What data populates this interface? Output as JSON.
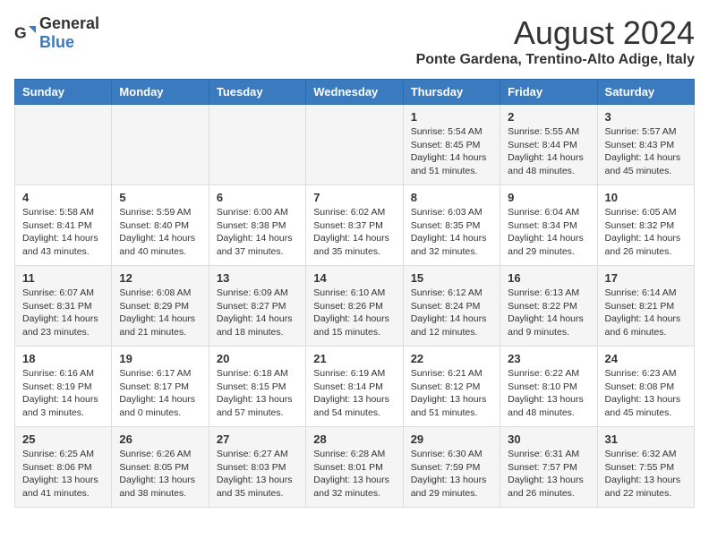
{
  "header": {
    "logo_general": "General",
    "logo_blue": "Blue",
    "main_title": "August 2024",
    "subtitle": "Ponte Gardena, Trentino-Alto Adige, Italy"
  },
  "days_of_week": [
    "Sunday",
    "Monday",
    "Tuesday",
    "Wednesday",
    "Thursday",
    "Friday",
    "Saturday"
  ],
  "weeks": [
    {
      "days": [
        {
          "number": "",
          "info": ""
        },
        {
          "number": "",
          "info": ""
        },
        {
          "number": "",
          "info": ""
        },
        {
          "number": "",
          "info": ""
        },
        {
          "number": "1",
          "info": "Sunrise: 5:54 AM\nSunset: 8:45 PM\nDaylight: 14 hours\nand 51 minutes."
        },
        {
          "number": "2",
          "info": "Sunrise: 5:55 AM\nSunset: 8:44 PM\nDaylight: 14 hours\nand 48 minutes."
        },
        {
          "number": "3",
          "info": "Sunrise: 5:57 AM\nSunset: 8:43 PM\nDaylight: 14 hours\nand 45 minutes."
        }
      ]
    },
    {
      "days": [
        {
          "number": "4",
          "info": "Sunrise: 5:58 AM\nSunset: 8:41 PM\nDaylight: 14 hours\nand 43 minutes."
        },
        {
          "number": "5",
          "info": "Sunrise: 5:59 AM\nSunset: 8:40 PM\nDaylight: 14 hours\nand 40 minutes."
        },
        {
          "number": "6",
          "info": "Sunrise: 6:00 AM\nSunset: 8:38 PM\nDaylight: 14 hours\nand 37 minutes."
        },
        {
          "number": "7",
          "info": "Sunrise: 6:02 AM\nSunset: 8:37 PM\nDaylight: 14 hours\nand 35 minutes."
        },
        {
          "number": "8",
          "info": "Sunrise: 6:03 AM\nSunset: 8:35 PM\nDaylight: 14 hours\nand 32 minutes."
        },
        {
          "number": "9",
          "info": "Sunrise: 6:04 AM\nSunset: 8:34 PM\nDaylight: 14 hours\nand 29 minutes."
        },
        {
          "number": "10",
          "info": "Sunrise: 6:05 AM\nSunset: 8:32 PM\nDaylight: 14 hours\nand 26 minutes."
        }
      ]
    },
    {
      "days": [
        {
          "number": "11",
          "info": "Sunrise: 6:07 AM\nSunset: 8:31 PM\nDaylight: 14 hours\nand 23 minutes."
        },
        {
          "number": "12",
          "info": "Sunrise: 6:08 AM\nSunset: 8:29 PM\nDaylight: 14 hours\nand 21 minutes."
        },
        {
          "number": "13",
          "info": "Sunrise: 6:09 AM\nSunset: 8:27 PM\nDaylight: 14 hours\nand 18 minutes."
        },
        {
          "number": "14",
          "info": "Sunrise: 6:10 AM\nSunset: 8:26 PM\nDaylight: 14 hours\nand 15 minutes."
        },
        {
          "number": "15",
          "info": "Sunrise: 6:12 AM\nSunset: 8:24 PM\nDaylight: 14 hours\nand 12 minutes."
        },
        {
          "number": "16",
          "info": "Sunrise: 6:13 AM\nSunset: 8:22 PM\nDaylight: 14 hours\nand 9 minutes."
        },
        {
          "number": "17",
          "info": "Sunrise: 6:14 AM\nSunset: 8:21 PM\nDaylight: 14 hours\nand 6 minutes."
        }
      ]
    },
    {
      "days": [
        {
          "number": "18",
          "info": "Sunrise: 6:16 AM\nSunset: 8:19 PM\nDaylight: 14 hours\nand 3 minutes."
        },
        {
          "number": "19",
          "info": "Sunrise: 6:17 AM\nSunset: 8:17 PM\nDaylight: 14 hours\nand 0 minutes."
        },
        {
          "number": "20",
          "info": "Sunrise: 6:18 AM\nSunset: 8:15 PM\nDaylight: 13 hours\nand 57 minutes."
        },
        {
          "number": "21",
          "info": "Sunrise: 6:19 AM\nSunset: 8:14 PM\nDaylight: 13 hours\nand 54 minutes."
        },
        {
          "number": "22",
          "info": "Sunrise: 6:21 AM\nSunset: 8:12 PM\nDaylight: 13 hours\nand 51 minutes."
        },
        {
          "number": "23",
          "info": "Sunrise: 6:22 AM\nSunset: 8:10 PM\nDaylight: 13 hours\nand 48 minutes."
        },
        {
          "number": "24",
          "info": "Sunrise: 6:23 AM\nSunset: 8:08 PM\nDaylight: 13 hours\nand 45 minutes."
        }
      ]
    },
    {
      "days": [
        {
          "number": "25",
          "info": "Sunrise: 6:25 AM\nSunset: 8:06 PM\nDaylight: 13 hours\nand 41 minutes."
        },
        {
          "number": "26",
          "info": "Sunrise: 6:26 AM\nSunset: 8:05 PM\nDaylight: 13 hours\nand 38 minutes."
        },
        {
          "number": "27",
          "info": "Sunrise: 6:27 AM\nSunset: 8:03 PM\nDaylight: 13 hours\nand 35 minutes."
        },
        {
          "number": "28",
          "info": "Sunrise: 6:28 AM\nSunset: 8:01 PM\nDaylight: 13 hours\nand 32 minutes."
        },
        {
          "number": "29",
          "info": "Sunrise: 6:30 AM\nSunset: 7:59 PM\nDaylight: 13 hours\nand 29 minutes."
        },
        {
          "number": "30",
          "info": "Sunrise: 6:31 AM\nSunset: 7:57 PM\nDaylight: 13 hours\nand 26 minutes."
        },
        {
          "number": "31",
          "info": "Sunrise: 6:32 AM\nSunset: 7:55 PM\nDaylight: 13 hours\nand 22 minutes."
        }
      ]
    }
  ]
}
